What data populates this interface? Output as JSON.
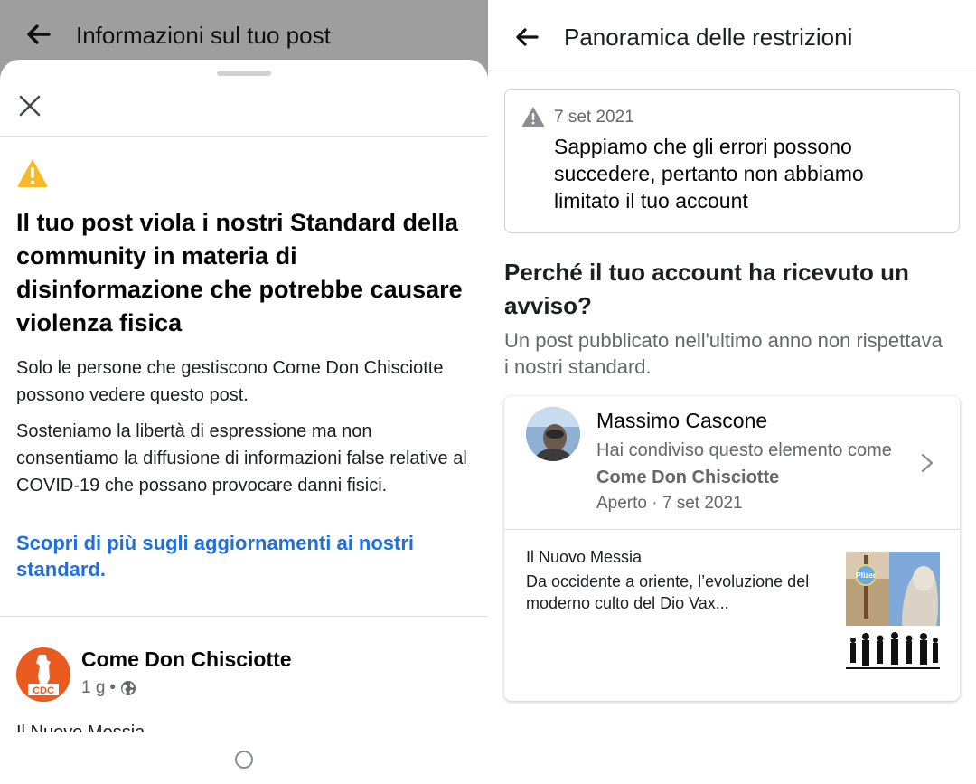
{
  "left_screen": {
    "header_title": "Informazioni sul tuo post",
    "headline": "Il tuo post viola i nostri Standard della community in materia di disinformazione che potrebbe causare violenza fisica",
    "paragraph_1": "Solo le persone che gestiscono Come Don Chisciotte possono vedere questo post.",
    "paragraph_2": "Sosteniamo la libertà di espressione ma non consentiamo la diffusione di informazioni false relative al COVID-19 che possano provocare danni fisici.",
    "learn_more_link": "Scopri di più sugli aggiornamenti ai nostri standard.",
    "post": {
      "page_name": "Come Don Chisciotte",
      "avatar_text": "CDC",
      "time": "1 g",
      "separator": "•",
      "preview_text": "Il Nuovo Messia"
    }
  },
  "right_screen": {
    "header_title": "Panoramica delle restrizioni",
    "notice": {
      "date": "7 set 2021",
      "text": "Sappiamo che gli errori possono succedere, pertanto non abbiamo limitato il tuo account"
    },
    "why_heading": "Perché il tuo account ha ricevuto un avviso?",
    "why_sub": "Un post pubblicato nell'ultimo anno non rispettava i nostri standard.",
    "card": {
      "user_name": "Massimo Cascone",
      "shared_prefix": "Hai condiviso questo elemento come",
      "shared_as": "Come Don Chisciotte",
      "status": "Aperto · 7 set 2021",
      "source": "Il Nuovo Messia",
      "article_title": "Da occidente a oriente, l’evoluzione del moderno culto del Dio Vax...",
      "thumbnail_label": "Pfizer"
    }
  },
  "colors": {
    "warning_yellow": "#f7b928",
    "link_blue": "#216fdb",
    "secondary_text": "#65676b",
    "dim_overlay": "#9e9e9e",
    "page_avatar_orange": "#ea5b1f"
  },
  "icons": {
    "back": "arrow-left-icon",
    "close": "close-icon",
    "warning": "warning-triangle-icon",
    "globe": "globe-icon",
    "chevron": "chevron-right-icon"
  }
}
